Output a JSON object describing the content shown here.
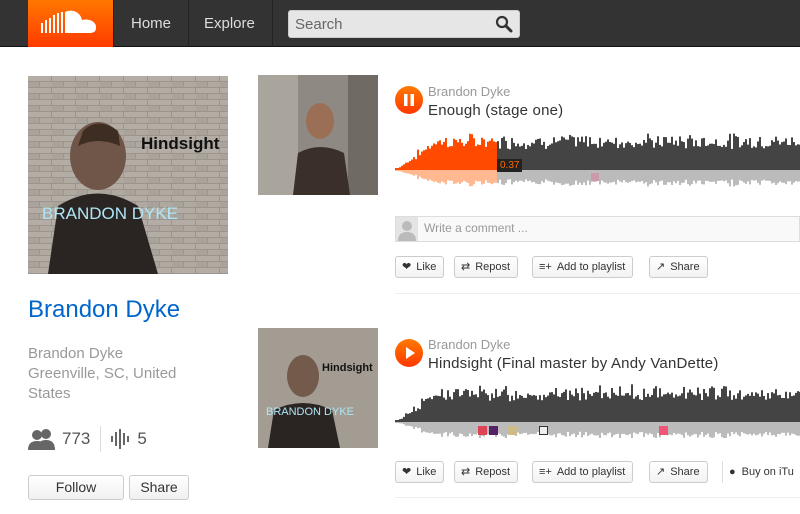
{
  "header": {
    "nav": [
      "Home",
      "Explore"
    ],
    "search_placeholder": "Search"
  },
  "artist": {
    "name": "Brandon Dyke",
    "username": "Brandon Dyke",
    "location": "Greenville, SC, United States",
    "followers": "773",
    "tracks": "5",
    "follow_label": "Follow",
    "share_label": "Share",
    "cover_text_title": "Hindsight",
    "cover_text_name": "BRANDON DYKE"
  },
  "tracks": [
    {
      "user": "Brandon Dyke",
      "title": "Enough (stage one)",
      "state": "playing",
      "current_time": "0.37",
      "comment_placeholder": "Write a comment ...",
      "actions": [
        "Like",
        "Repost",
        "Add to playlist",
        "Share"
      ]
    },
    {
      "user": "Brandon Dyke",
      "title": "Hindsight (Final master by Andy VanDette)",
      "state": "paused",
      "actions": [
        "Like",
        "Repost",
        "Add to playlist",
        "Share"
      ],
      "buy_label": "Buy on iTu",
      "thumb_text_title": "Hindsight",
      "thumb_text_name": "BRANDON DYKE"
    }
  ],
  "colors": {
    "accent": "#ff5500",
    "link": "#0066cc",
    "header_bg": "#333333"
  }
}
